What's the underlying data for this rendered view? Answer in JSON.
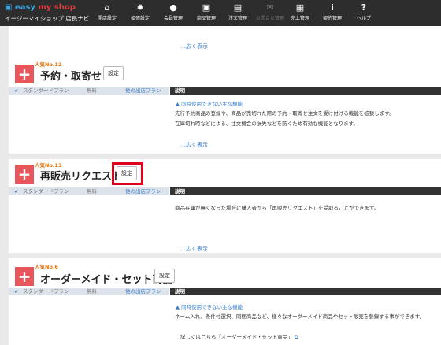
{
  "header": {
    "logo_part1": "easy",
    "logo_part2": "my shop",
    "subtitle": "イージーマイショップ 店長ナビ",
    "nav": [
      {
        "label": "開店設定",
        "icon": "home-icon",
        "glyph": "⌂"
      },
      {
        "label": "拡張設定",
        "icon": "gear-icon",
        "glyph": "✹"
      },
      {
        "label": "会員管理",
        "icon": "user-icon",
        "glyph": "●"
      },
      {
        "label": "商品管理",
        "icon": "gift-icon",
        "glyph": "▣"
      },
      {
        "label": "注文管理",
        "icon": "document-icon",
        "glyph": "▤"
      },
      {
        "label": "お問合せ管理",
        "icon": "mail-icon",
        "glyph": "✉"
      },
      {
        "label": "売上管理",
        "icon": "calculator-icon",
        "glyph": "▦"
      },
      {
        "label": "契約管理",
        "icon": "info-icon",
        "glyph": "i"
      },
      {
        "label": "ヘルプ",
        "icon": "help-icon",
        "glyph": "?"
      }
    ]
  },
  "top_card": {
    "more": "…広く表示"
  },
  "cards": [
    {
      "rank": "人気No.12",
      "title": "予約・取寄せ",
      "set_label": "設定",
      "plan": "スタンダードプラン",
      "price": "無料",
      "other_plan": "他の出店プラン",
      "desc_header": "説明",
      "warning": "同時使用できない主な機能",
      "line1": "先行予約商品の登録や、商品が売切れた際の予約・取寄せ注文を受け付ける機能を拡張します。",
      "line2": "在庫切れ時などによる、注文機会の損失などを防ぐため有効な機能となります。",
      "more": "…広く表示"
    },
    {
      "rank": "人気No.13",
      "title": "再販売リクエスト",
      "set_label": "設定",
      "plan": "スタンダードプラン",
      "price": "無料",
      "other_plan": "他の出店プラン",
      "desc_header": "説明",
      "line1": "商品在庫が無くなった場合に購入者から「再販売リクエスト」を受取ることができます。",
      "more": "…広く表示"
    },
    {
      "rank": "人気No.6",
      "title": "オーダーメイド・セット商品",
      "set_label": "設定",
      "plan": "スタンダードプラン",
      "price": "無料",
      "other_plan": "他の出店プラン",
      "desc_header": "説明",
      "warning": "同時使用できない主な機能",
      "line1": "ネーム入れ、条件付選択、同梱商品など、様々なオーダーメイド商品やセット販売を登録する事ができます。",
      "link": "詳しくはこちら「オーダーメイド・セット商品」"
    }
  ]
}
